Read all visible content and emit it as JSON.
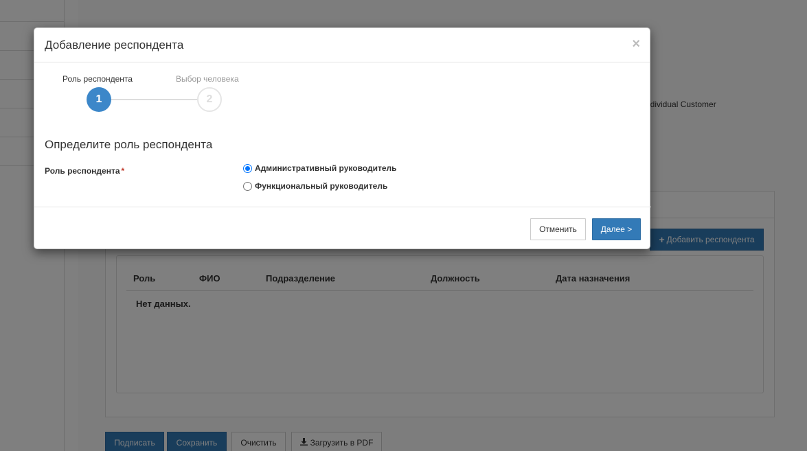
{
  "background": {
    "customer_label": "ndividual Customer",
    "add_respondent_button": "Добавить респондента",
    "table": {
      "columns": [
        "Роль",
        "ФИО",
        "Подразделение",
        "Должность",
        "Дата назначения"
      ],
      "empty_text": "Нет данных."
    },
    "bottom_buttons": {
      "sign": "Подписать",
      "save": "Сохранить",
      "clear": "Очистить",
      "download_pdf": "Загрузить в PDF"
    }
  },
  "modal": {
    "title": "Добавление респондента",
    "close": "×",
    "steps": [
      {
        "label": "Роль респондента",
        "number": "1",
        "state": "active"
      },
      {
        "label": "Выбор человека",
        "number": "2",
        "state": "inactive"
      }
    ],
    "section_title": "Определите роль респондента",
    "field_label": "Роль респондента",
    "required_mark": "*",
    "options": [
      {
        "label": "Административный руководитель",
        "checked": true
      },
      {
        "label": "Функциональный руководитель",
        "checked": false
      }
    ],
    "buttons": {
      "cancel": "Отменить",
      "next": "Далее >"
    }
  },
  "colors": {
    "primary": "#337ab7",
    "step_active": "#3c87c9",
    "required": "#c0392b"
  }
}
